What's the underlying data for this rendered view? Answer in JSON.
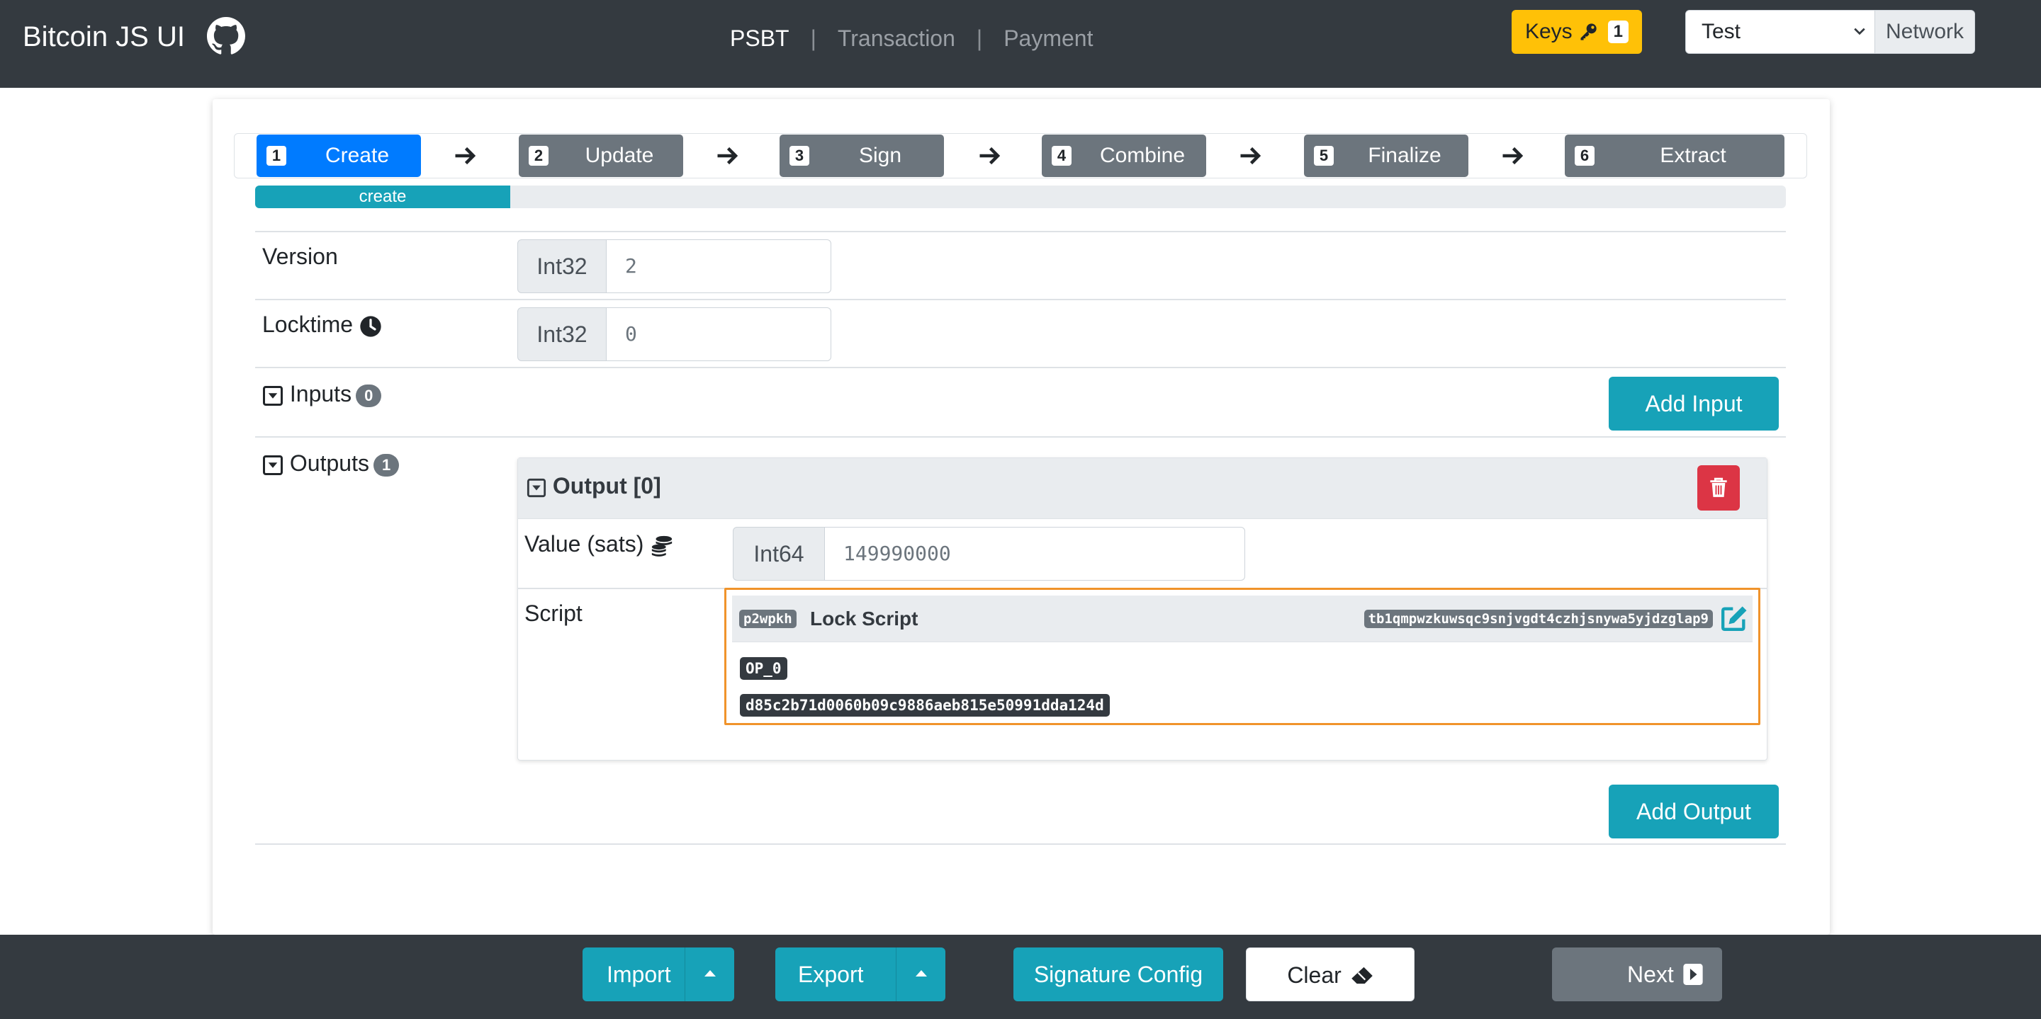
{
  "app": {
    "title": "Bitcoin JS UI"
  },
  "nav": {
    "links": [
      {
        "label": "PSBT",
        "active": true
      },
      {
        "label": "Transaction",
        "active": false
      },
      {
        "label": "Payment",
        "active": false
      }
    ],
    "separator": "|",
    "keys": {
      "label": "Keys",
      "count": "1",
      "icon": "key-icon"
    },
    "network": {
      "selected": "Test",
      "label": "Network"
    }
  },
  "steps": [
    {
      "num": "1",
      "label": "Create",
      "active": true
    },
    {
      "num": "2",
      "label": "Update",
      "active": false
    },
    {
      "num": "3",
      "label": "Sign",
      "active": false
    },
    {
      "num": "4",
      "label": "Combine",
      "active": false
    },
    {
      "num": "5",
      "label": "Finalize",
      "active": false
    },
    {
      "num": "6",
      "label": "Extract",
      "active": false
    }
  ],
  "progress": {
    "label": "create",
    "fraction": 0.1667
  },
  "form": {
    "version": {
      "label": "Version",
      "type": "Int32",
      "value": "2"
    },
    "locktime": {
      "label": "Locktime",
      "type": "Int32",
      "value": "0",
      "icon": "clock-icon"
    },
    "inputs": {
      "label": "Inputs",
      "count": "0",
      "add_label": "Add Input"
    },
    "outputs": {
      "label": "Outputs",
      "count": "1",
      "add_label": "Add Output"
    }
  },
  "output": {
    "title": "Output [0]",
    "value": {
      "label": "Value (sats)",
      "type": "Int64",
      "value": "149990000",
      "icon": "coins-icon"
    },
    "script": {
      "label": "Script",
      "type_badge": "p2wpkh",
      "title": "Lock Script",
      "address": "tb1qmpwzkuwsqc9snjvgdt4czhjsnywa5yjdzglap9",
      "ops": [
        "OP_0",
        "d85c2b71d0060b09c9886aeb815e50991dda124d"
      ]
    }
  },
  "bottom": {
    "import": "Import",
    "export": "Export",
    "signature_config": "Signature Config",
    "clear": "Clear",
    "next": "Next"
  },
  "colors": {
    "primary": "#007bff",
    "info": "#17a2b8",
    "secondary": "#6c757d",
    "danger": "#dc3545",
    "warning": "#ffc107",
    "dark": "#343a40",
    "highlight": "#f0932b"
  }
}
